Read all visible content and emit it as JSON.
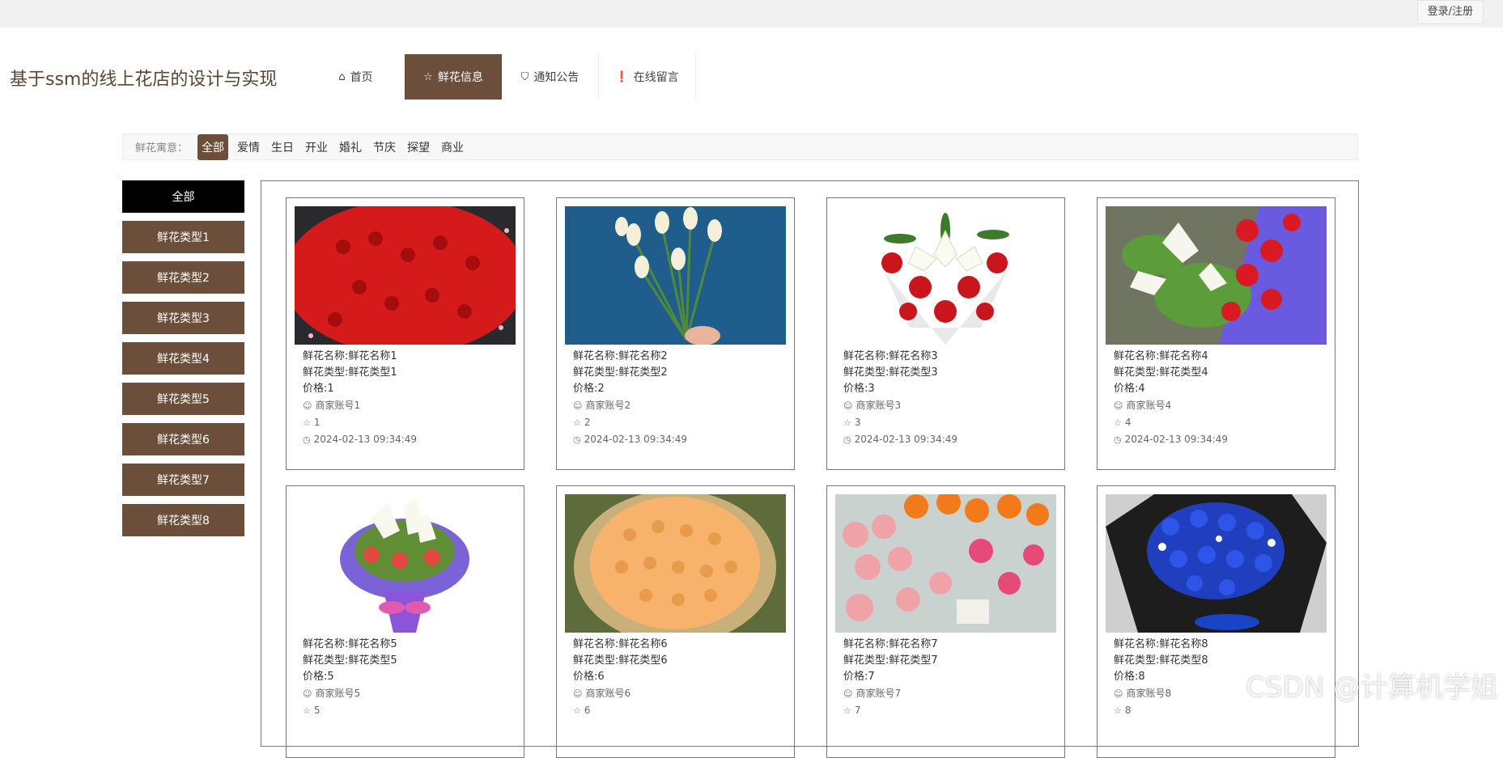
{
  "header": {
    "login_label": "登录/注册",
    "site_title": "基于ssm的线上花店的设计与实现"
  },
  "nav": [
    {
      "label": "首页",
      "icon": "home-icon",
      "glyph": "⌂"
    },
    {
      "label": "鲜花信息",
      "icon": "star-icon",
      "glyph": "☆"
    },
    {
      "label": "通知公告",
      "icon": "bag-icon",
      "glyph": "⛉"
    },
    {
      "label": "在线留言",
      "icon": "alert-icon",
      "glyph": "❗"
    }
  ],
  "filter": {
    "label": "鲜花寓意：",
    "options": [
      "全部",
      "爱情",
      "生日",
      "开业",
      "婚礼",
      "节庆",
      "探望",
      "商业"
    ]
  },
  "sidebar": [
    "全部",
    "鲜花类型1",
    "鲜花类型2",
    "鲜花类型3",
    "鲜花类型4",
    "鲜花类型5",
    "鲜花类型6",
    "鲜花类型7",
    "鲜花类型8"
  ],
  "products": [
    {
      "name": "鲜花名称:鲜花名称1",
      "type": "鲜花类型:鲜花类型1",
      "price": "价格:1",
      "merchant": "商家账号1",
      "stars": "1",
      "time": "2024-02-13 09:34:49"
    },
    {
      "name": "鲜花名称:鲜花名称2",
      "type": "鲜花类型:鲜花类型2",
      "price": "价格:2",
      "merchant": "商家账号2",
      "stars": "2",
      "time": "2024-02-13 09:34:49"
    },
    {
      "name": "鲜花名称:鲜花名称3",
      "type": "鲜花类型:鲜花类型3",
      "price": "价格:3",
      "merchant": "商家账号3",
      "stars": "3",
      "time": "2024-02-13 09:34:49"
    },
    {
      "name": "鲜花名称:鲜花名称4",
      "type": "鲜花类型:鲜花类型4",
      "price": "价格:4",
      "merchant": "商家账号4",
      "stars": "4",
      "time": "2024-02-13 09:34:49"
    },
    {
      "name": "鲜花名称:鲜花名称5",
      "type": "鲜花类型:鲜花类型5",
      "price": "价格:5",
      "merchant": "商家账号5",
      "stars": "5",
      "time": ""
    },
    {
      "name": "鲜花名称:鲜花名称6",
      "type": "鲜花类型:鲜花类型6",
      "price": "价格:6",
      "merchant": "商家账号6",
      "stars": "6",
      "time": ""
    },
    {
      "name": "鲜花名称:鲜花名称7",
      "type": "鲜花类型:鲜花类型7",
      "price": "价格:7",
      "merchant": "商家账号7",
      "stars": "7",
      "time": ""
    },
    {
      "name": "鲜花名称:鲜花名称8",
      "type": "鲜花类型:鲜花类型8",
      "price": "价格:8",
      "merchant": "商家账号8",
      "stars": "8",
      "time": ""
    }
  ],
  "colors": {
    "brand": "#6b4f3b",
    "sidebar_active": "#000000"
  },
  "watermark": "CSDN @计算机学姐"
}
